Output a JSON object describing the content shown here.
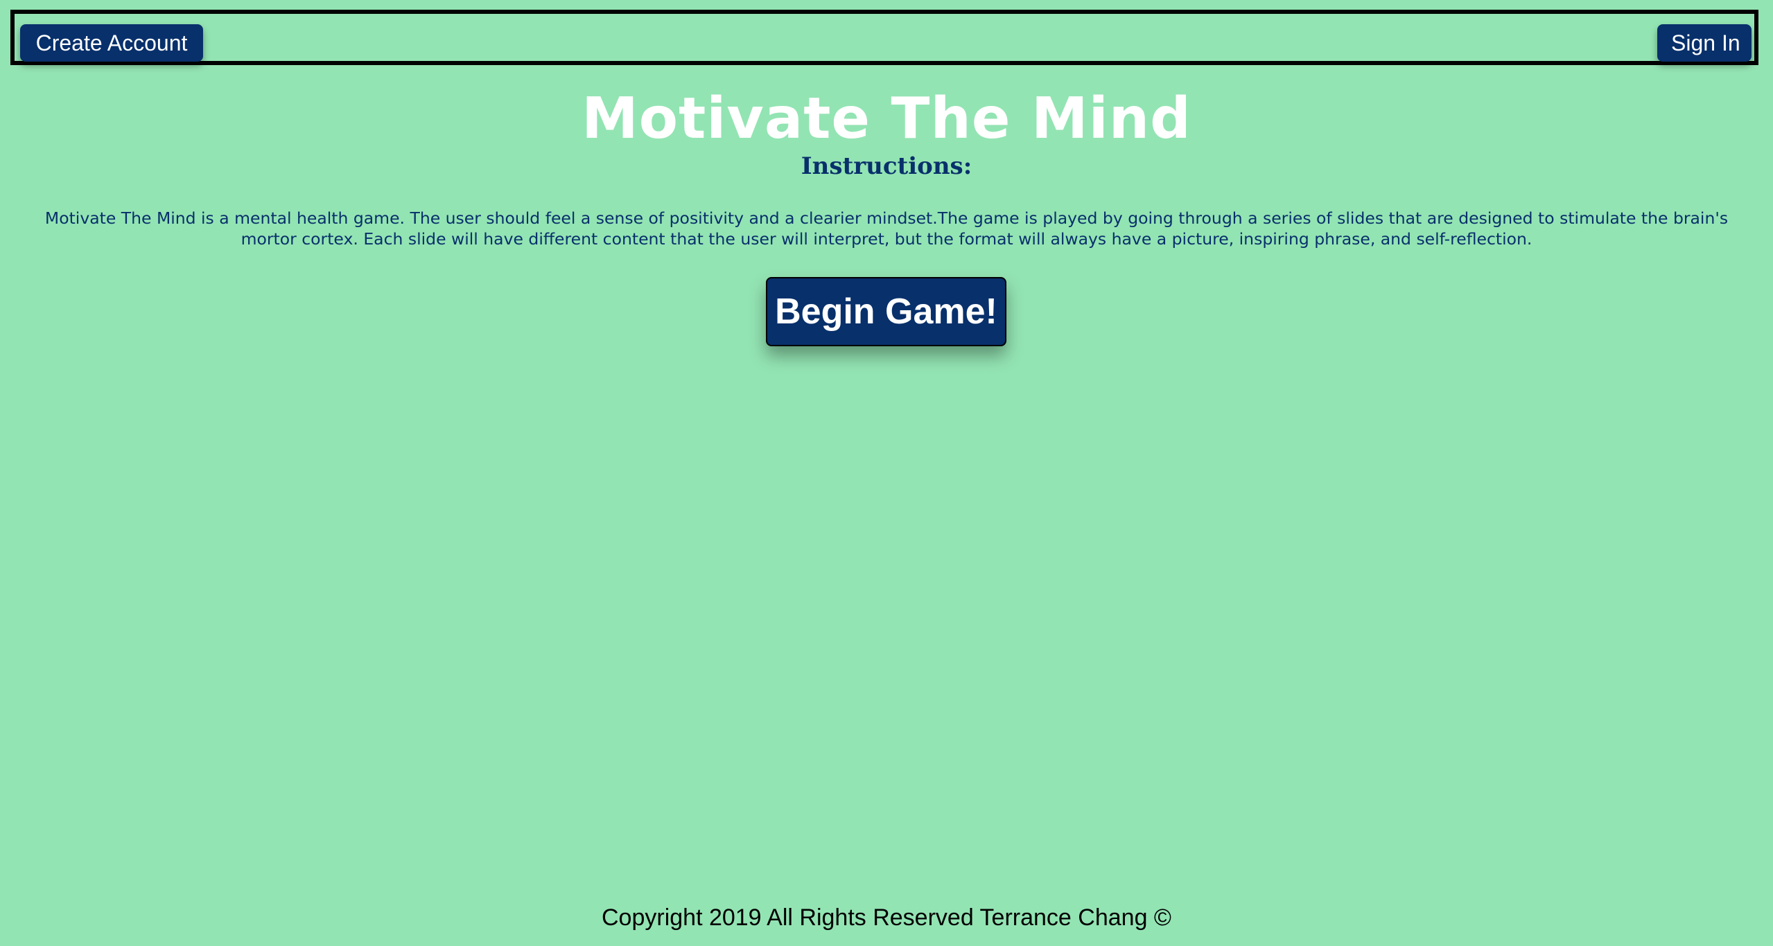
{
  "header": {
    "create_account_label": "Create Account",
    "sign_in_label": "Sign In"
  },
  "main": {
    "title": "Motivate The Mind",
    "subtitle": "Instructions:",
    "instructions": "Motivate The Mind is a mental health game. The user should feel a sense of positivity and a clearier mindset.The game is played by going through a series of slides that are designed to stimulate the brain's mortor cortex. Each slide will have different content that the user will interpret, but the format will always have a picture, inspiring phrase, and self-reflection.",
    "begin_label": "Begin Game!"
  },
  "footer": {
    "copyright": "Copyright 2019 All Rights Reserved Terrance Chang ©"
  },
  "colors": {
    "background": "#93e4b3",
    "button": "#08306b",
    "button_text": "#ffffff",
    "heading_text": "#ffffff",
    "body_text": "#08306b"
  }
}
